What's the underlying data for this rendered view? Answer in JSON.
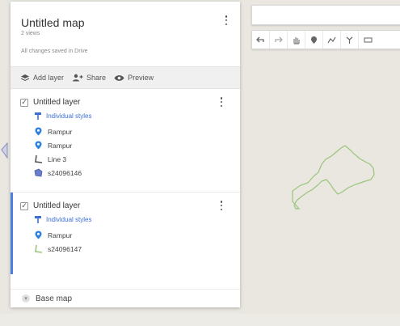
{
  "map": {
    "title": "Untitled map",
    "views": "2 views",
    "save_status": "All changes saved in Drive"
  },
  "actions": {
    "add_layer": "Add layer",
    "share": "Share",
    "preview": "Preview"
  },
  "layers": [
    {
      "name": "Untitled layer",
      "style": "Individual styles",
      "checked": true,
      "selected": false,
      "features": [
        {
          "label": "Rampur",
          "icon": "pin-icon"
        },
        {
          "label": "Rampur",
          "icon": "pin-icon"
        },
        {
          "label": "Line 3",
          "icon": "line-icon"
        },
        {
          "label": "s24096146",
          "icon": "polygon-icon"
        }
      ]
    },
    {
      "name": "Untitled layer",
      "style": "Individual styles",
      "checked": true,
      "selected": true,
      "features": [
        {
          "label": "Rampur",
          "icon": "pin-icon"
        },
        {
          "label": "s24096147",
          "icon": "line-icon"
        }
      ]
    }
  ],
  "basemap": {
    "label": "Base map"
  },
  "toolbar": {
    "tools": [
      "undo-icon",
      "redo-icon",
      "hand-icon",
      "marker-icon",
      "draw-line-icon",
      "route-icon",
      "measure-icon"
    ]
  },
  "colors": {
    "accent": "#4a7fdb",
    "link": "#3c6fd6",
    "pin": "#2f7fe0",
    "shape": "#9cc47a"
  }
}
